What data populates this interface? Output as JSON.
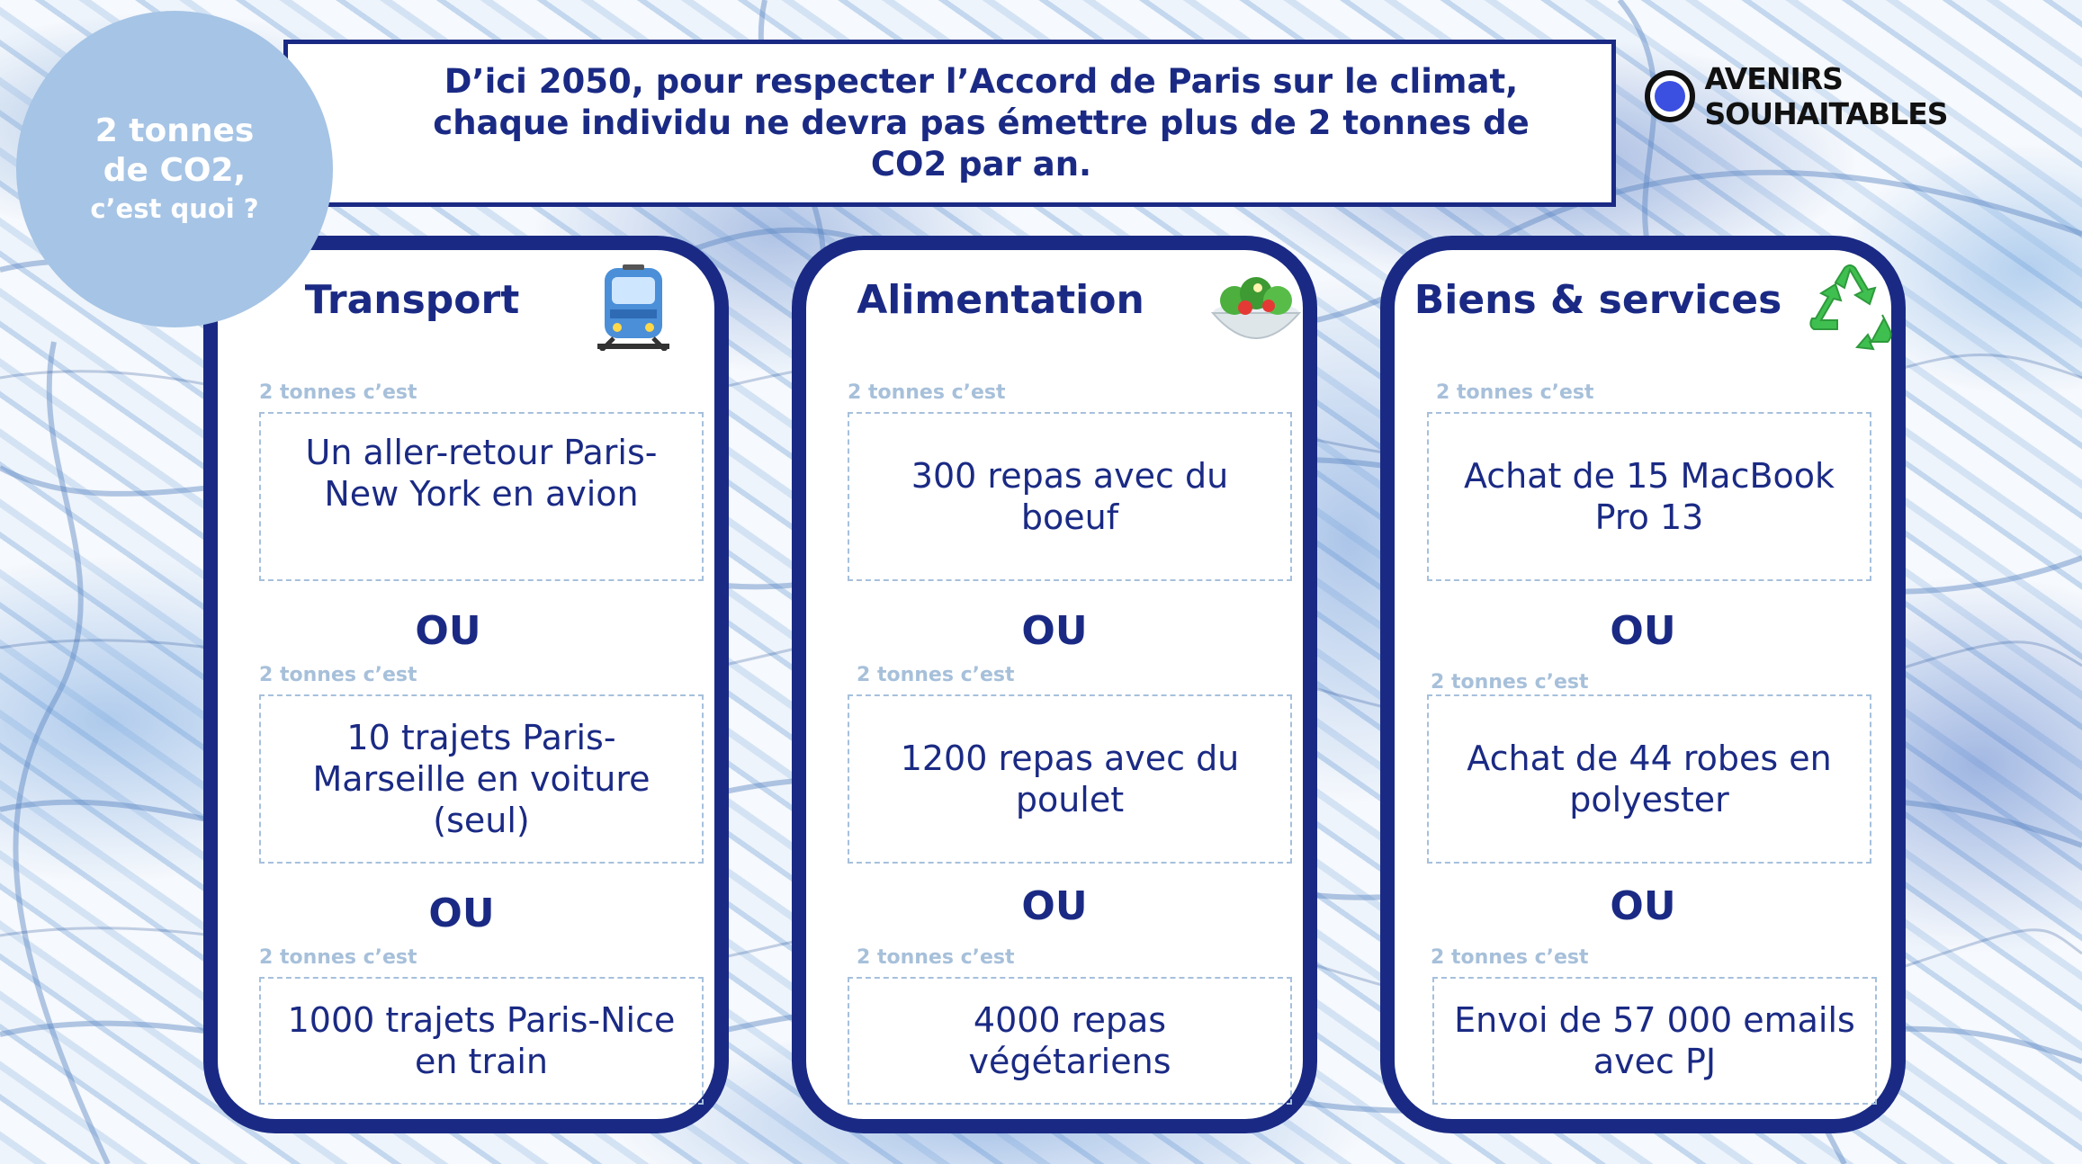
{
  "badge": {
    "line1": "2 tonnes",
    "line2": "de CO2,",
    "line3": "c’est quoi ?"
  },
  "headline": "D’ici 2050, pour respecter l’Accord de Paris sur le climat, chaque individu ne devra pas émettre plus de 2 tonnes de CO2 par an.",
  "brand": {
    "name": "AVENIRS SOUHAITABLES"
  },
  "or_label": "OU",
  "item_label": "2 tonnes c’est",
  "cards": [
    {
      "title": "Transport",
      "icon": "tram-icon",
      "items": [
        "Un aller-retour Paris-New York en avion",
        "10 trajets Paris-Marseille en voiture (seul)",
        "1000 trajets Paris-Nice en train"
      ]
    },
    {
      "title": "Alimentation",
      "icon": "salad-bowl-icon",
      "items": [
        "300 repas avec du boeuf",
        "1200 repas avec du poulet",
        "4000 repas végétariens"
      ]
    },
    {
      "title": "Biens & services",
      "icon": "recycle-icon",
      "items": [
        "Achat de 15 MacBook Pro 13",
        "Achat de 44 robes en polyester",
        "Envoi de 57 000 emails avec PJ"
      ]
    }
  ],
  "colors": {
    "navy": "#1a2a84",
    "badge": "#a6c4e5",
    "label": "#a7c0da",
    "brand_dot": "#3b4fe0",
    "recycle": "#3fbf4f"
  }
}
